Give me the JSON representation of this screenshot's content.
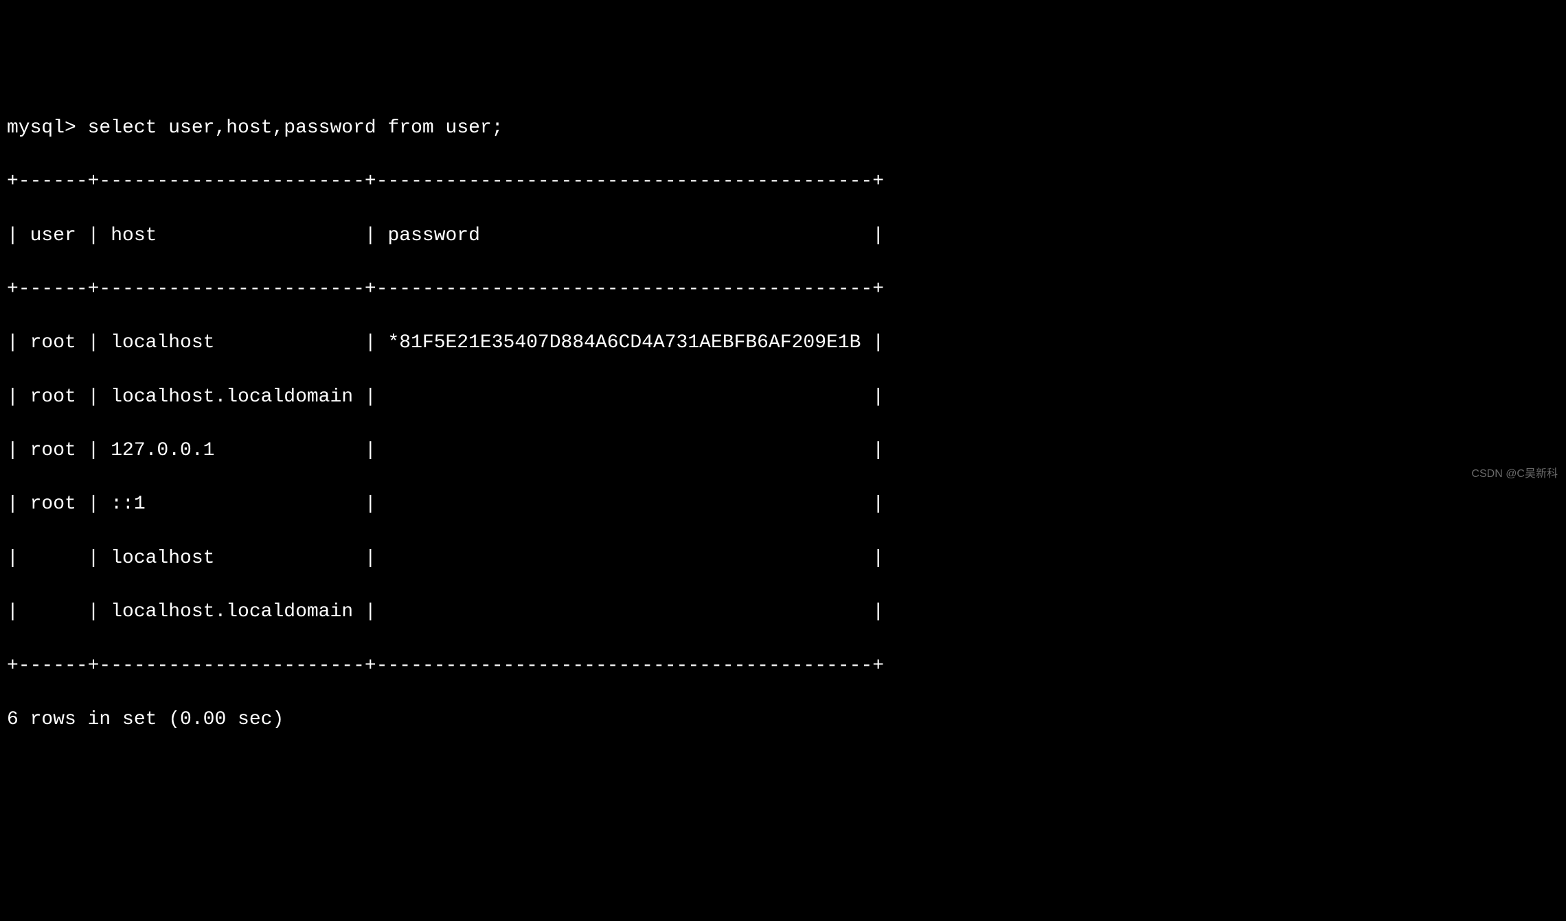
{
  "prompt": "mysql> ",
  "query": "select user,host,password from user;",
  "border_top": "+------+-----------------------+-------------------------------------------+",
  "header_line": "| user | host                  | password                                  |",
  "border_mid": "+------+-----------------------+-------------------------------------------+",
  "rows": [
    "| root | localhost             | *81F5E21E35407D884A6CD4A731AEBFB6AF209E1B |",
    "| root | localhost.localdomain |                                           |",
    "| root | 127.0.0.1             |                                           |",
    "| root | ::1                   |                                           |",
    "|      | localhost             |                                           |",
    "|      | localhost.localdomain |                                           |"
  ],
  "border_bottom": "+------+-----------------------+-------------------------------------------+",
  "summary": "6 rows in set (0.00 sec)",
  "watermark": "CSDN @C吴新科",
  "table": {
    "columns": [
      "user",
      "host",
      "password"
    ],
    "data": [
      {
        "user": "root",
        "host": "localhost",
        "password": "*81F5E21E35407D884A6CD4A731AEBFB6AF209E1B"
      },
      {
        "user": "root",
        "host": "localhost.localdomain",
        "password": ""
      },
      {
        "user": "root",
        "host": "127.0.0.1",
        "password": ""
      },
      {
        "user": "root",
        "host": "::1",
        "password": ""
      },
      {
        "user": "",
        "host": "localhost",
        "password": ""
      },
      {
        "user": "",
        "host": "localhost.localdomain",
        "password": ""
      }
    ]
  }
}
